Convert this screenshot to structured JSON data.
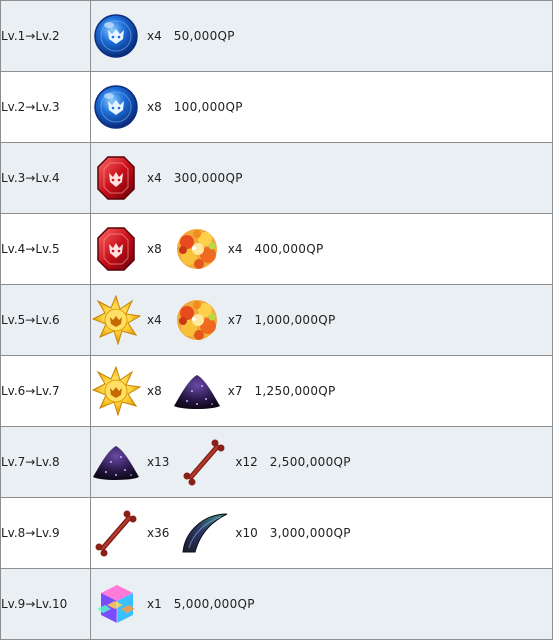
{
  "rows": [
    {
      "level": "Lv.1→Lv.2",
      "materials": [
        {
          "icon": "blue-gem-icon",
          "qty": "x4"
        }
      ],
      "qp": "50,000QP"
    },
    {
      "level": "Lv.2→Lv.3",
      "materials": [
        {
          "icon": "blue-gem-icon",
          "qty": "x8"
        }
      ],
      "qp": "100,000QP"
    },
    {
      "level": "Lv.3→Lv.4",
      "materials": [
        {
          "icon": "red-gem-icon",
          "qty": "x4"
        }
      ],
      "qp": "300,000QP"
    },
    {
      "level": "Lv.4→Lv.5",
      "materials": [
        {
          "icon": "red-gem-icon",
          "qty": "x8"
        },
        {
          "icon": "flower-cluster-icon",
          "qty": "x4"
        }
      ],
      "qp": "400,000QP"
    },
    {
      "level": "Lv.5→Lv.6",
      "materials": [
        {
          "icon": "gold-star-gem-icon",
          "qty": "x4"
        },
        {
          "icon": "flower-cluster-icon",
          "qty": "x7"
        }
      ],
      "qp": "1,000,000QP"
    },
    {
      "level": "Lv.6→Lv.7",
      "materials": [
        {
          "icon": "gold-star-gem-icon",
          "qty": "x8"
        },
        {
          "icon": "dark-pile-icon",
          "qty": "x7"
        }
      ],
      "qp": "1,250,000QP"
    },
    {
      "level": "Lv.7→Lv.8",
      "materials": [
        {
          "icon": "dark-pile-icon",
          "qty": "x13"
        },
        {
          "icon": "bone-icon",
          "qty": "x12"
        }
      ],
      "qp": "2,500,000QP"
    },
    {
      "level": "Lv.8→Lv.9",
      "materials": [
        {
          "icon": "bone-icon",
          "qty": "x36"
        },
        {
          "icon": "claw-icon",
          "qty": "x10"
        }
      ],
      "qp": "3,000,000QP"
    },
    {
      "level": "Lv.9→Lv.10",
      "materials": [
        {
          "icon": "crystal-cube-icon",
          "qty": "x1"
        }
      ],
      "qp": "5,000,000QP"
    }
  ],
  "colors": {
    "row_odd": "#eaeff3",
    "row_even": "#ffffff",
    "border": "#8e8e8e",
    "text": "#222222"
  }
}
